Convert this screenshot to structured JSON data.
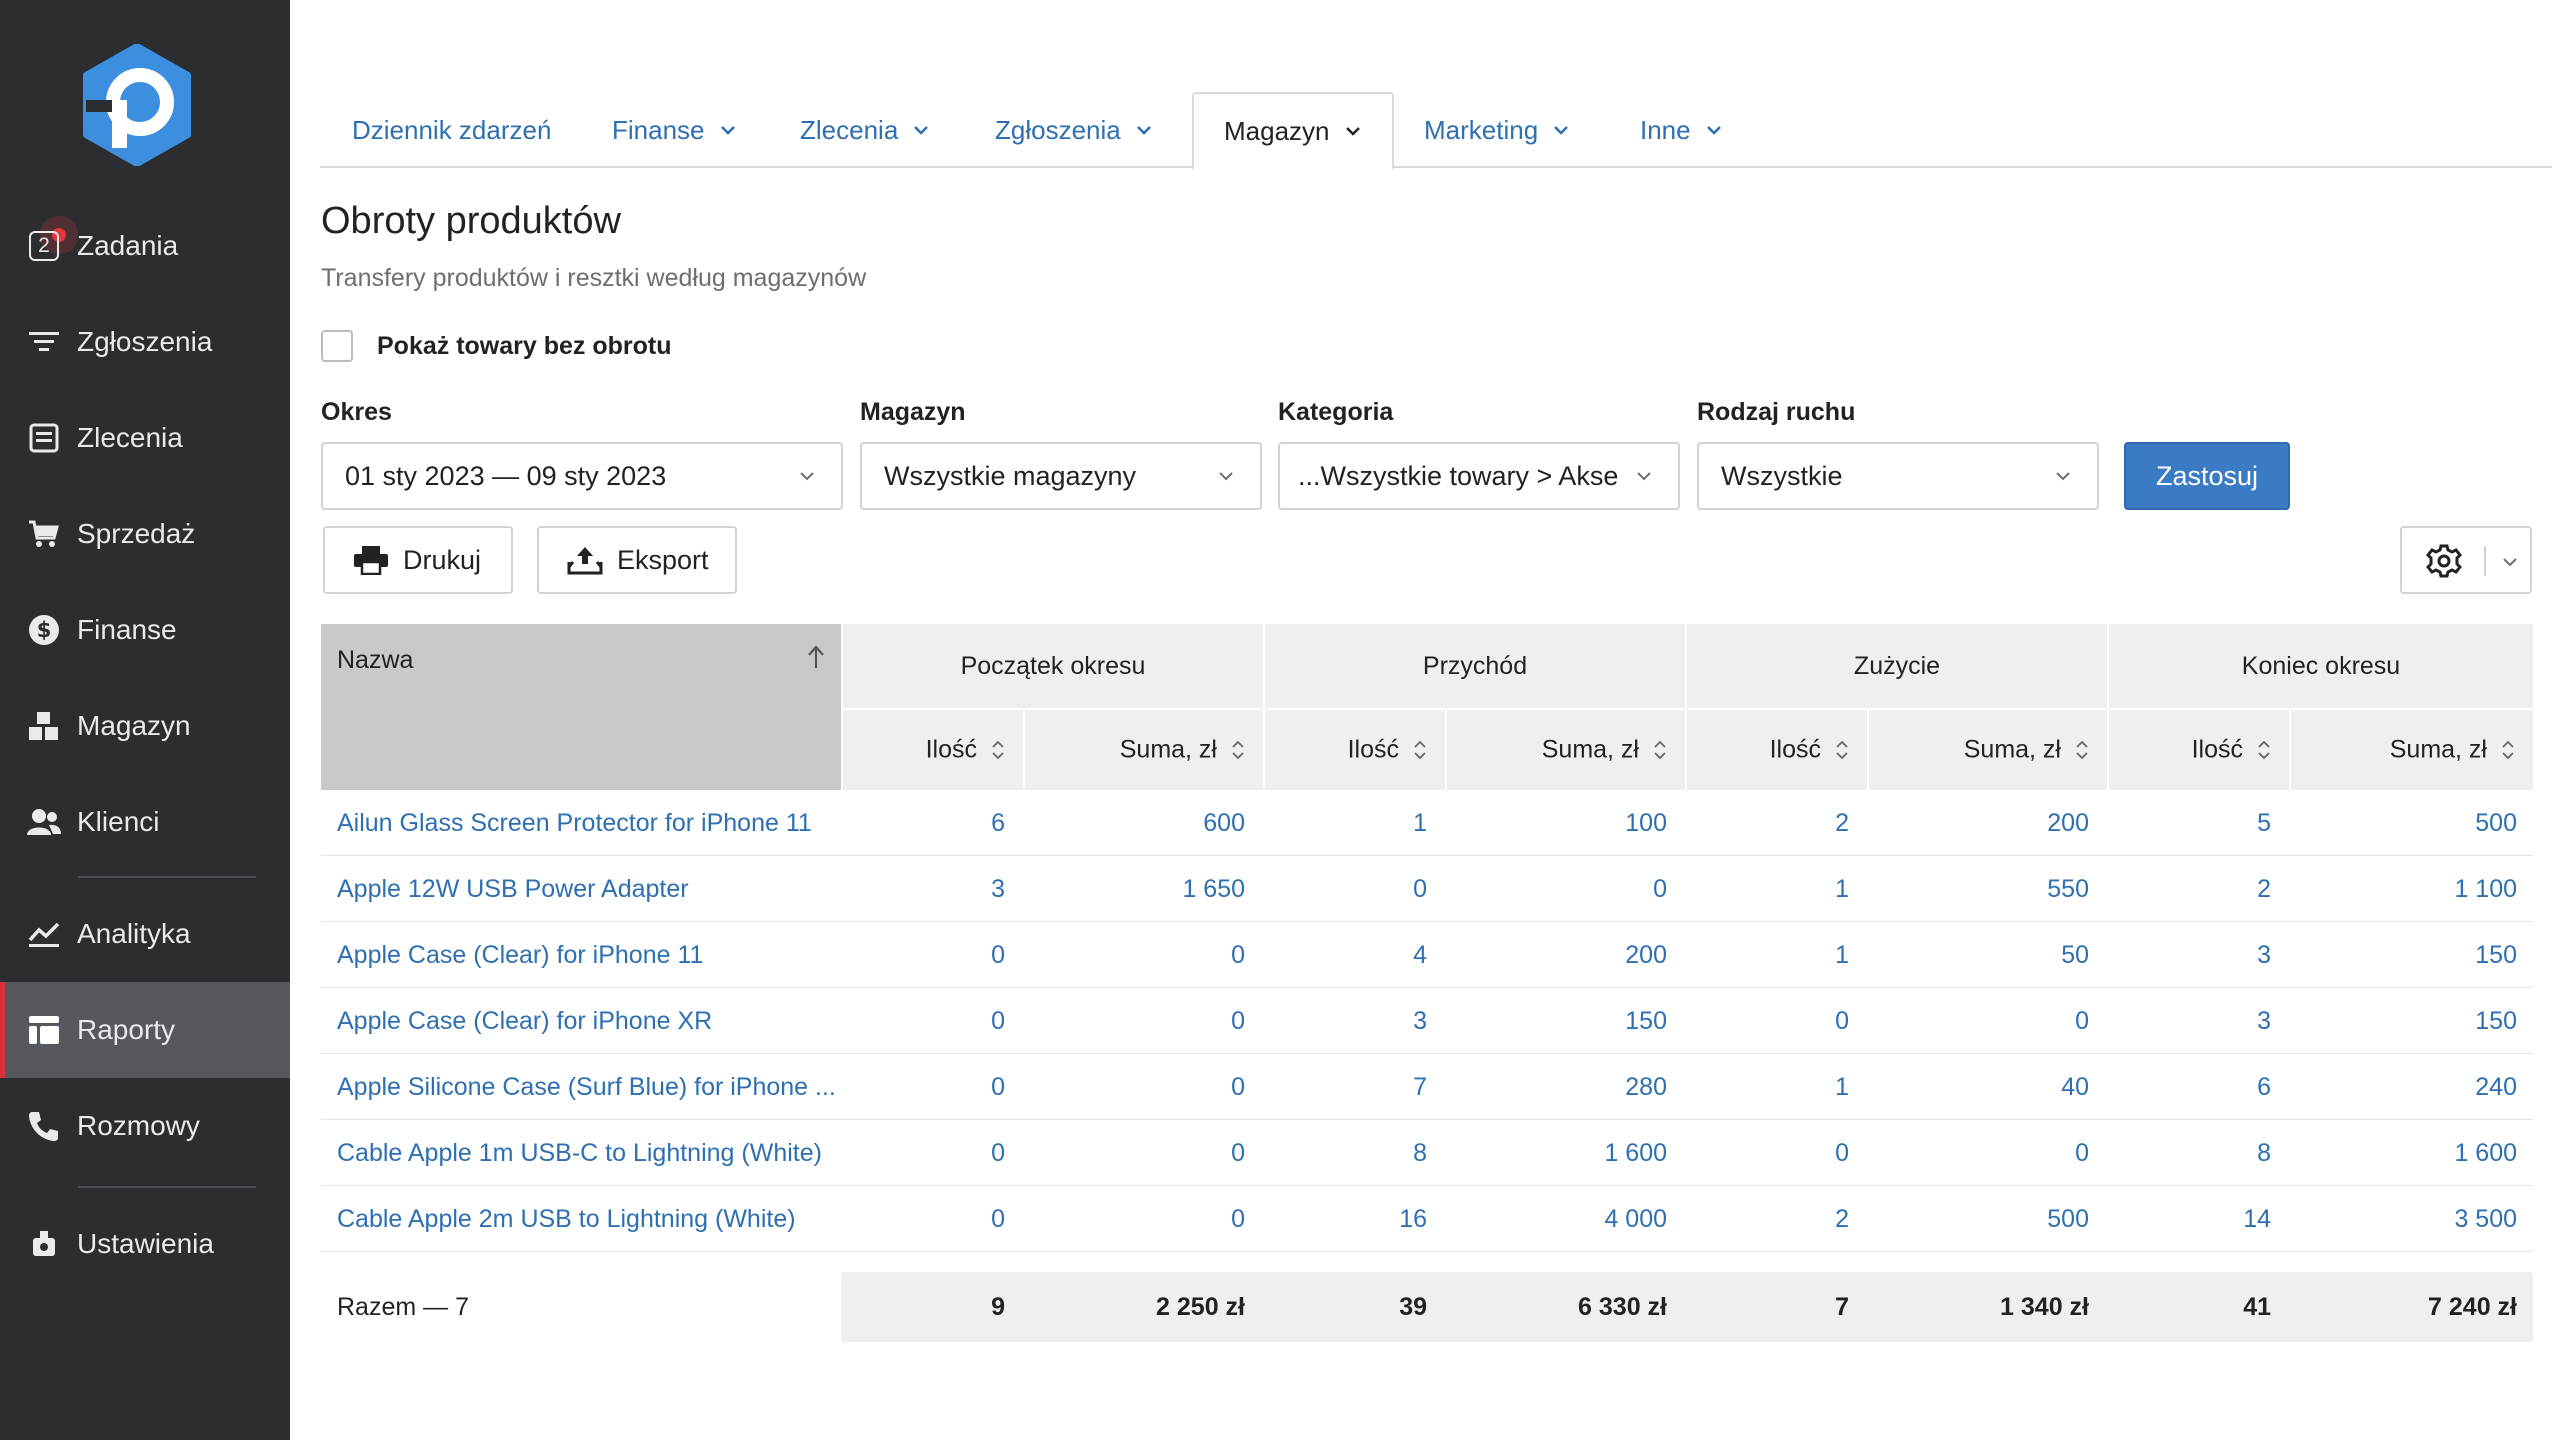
{
  "brand": {
    "accent": "#3b7bc4",
    "sidebar_bg": "#2b2d30",
    "active_marker": "#d9313a",
    "link": "#2e6fb2"
  },
  "sidebar": {
    "tasks_badge": "2",
    "items": [
      {
        "label": "Zadania",
        "icon": "tasks-icon"
      },
      {
        "label": "Zgłoszenia",
        "icon": "filter-icon"
      },
      {
        "label": "Zlecenia",
        "icon": "orders-icon"
      },
      {
        "label": "Sprzedaż",
        "icon": "cart-icon"
      },
      {
        "label": "Finanse",
        "icon": "dollar-icon"
      },
      {
        "label": "Magazyn",
        "icon": "warehouse-icon"
      },
      {
        "label": "Klienci",
        "icon": "clients-icon"
      },
      {
        "label": "Analityka",
        "icon": "analytics-icon"
      },
      {
        "label": "Raporty",
        "icon": "reports-icon",
        "active": true
      },
      {
        "label": "Rozmowy",
        "icon": "phone-icon"
      },
      {
        "label": "Ustawienia",
        "icon": "settings-icon"
      }
    ]
  },
  "tabs": [
    {
      "label": "Dziennik zdarzeń"
    },
    {
      "label": "Finanse"
    },
    {
      "label": "Zlecenia"
    },
    {
      "label": "Zgłoszenia"
    },
    {
      "label": "Magazyn",
      "active": true
    },
    {
      "label": "Marketing"
    },
    {
      "label": "Inne"
    }
  ],
  "header": {
    "title": "Obroty produktów",
    "subtitle": "Transfery produktów i resztki według magazynów",
    "checkbox_label": "Pokaż towary bez obrotu"
  },
  "filters": {
    "period_label": "Okres",
    "period_value": "01 sty 2023 — 09 sty 2023",
    "warehouse_label": "Magazyn",
    "warehouse_value": "Wszystkie magazyny",
    "category_label": "Kategoria",
    "category_value": "...Wszystkie towary > Akse",
    "movement_label": "Rodzaj ruchu",
    "movement_value": "Wszystkie",
    "apply_label": "Zastosuj"
  },
  "toolbar": {
    "print_label": "Drukuj",
    "export_label": "Eksport"
  },
  "table": {
    "name_header": "Nazwa",
    "groups": [
      "Początek okresu",
      "Przychód",
      "Zużycie",
      "Koniec okresu"
    ],
    "qty_header": "Ilość",
    "sum_header": "Suma, zł",
    "rows": [
      {
        "name": "Ailun Glass Screen Protector for iPhone 11",
        "v": [
          "6",
          "600",
          "1",
          "100",
          "2",
          "200",
          "5",
          "500"
        ]
      },
      {
        "name": "Apple 12W USB Power Adapter",
        "v": [
          "3",
          "1 650",
          "0",
          "0",
          "1",
          "550",
          "2",
          "1 100"
        ]
      },
      {
        "name": "Apple Case (Clear) for iPhone 11",
        "v": [
          "0",
          "0",
          "4",
          "200",
          "1",
          "50",
          "3",
          "150"
        ]
      },
      {
        "name": "Apple Case (Clear) for iPhone XR",
        "v": [
          "0",
          "0",
          "3",
          "150",
          "0",
          "0",
          "3",
          "150"
        ]
      },
      {
        "name": "Apple Silicone Case (Surf Blue) for iPhone ...",
        "v": [
          "0",
          "0",
          "7",
          "280",
          "1",
          "40",
          "6",
          "240"
        ]
      },
      {
        "name": "Cable Apple 1m USB-C to Lightning (White)",
        "v": [
          "0",
          "0",
          "8",
          "1 600",
          "0",
          "0",
          "8",
          "1 600"
        ]
      },
      {
        "name": "Cable Apple 2m USB to Lightning (White)",
        "v": [
          "0",
          "0",
          "16",
          "4 000",
          "2",
          "500",
          "14",
          "3 500"
        ]
      }
    ],
    "total_label": "Razem — 7",
    "totals": [
      "9",
      "2 250 zł",
      "39",
      "6 330 zł",
      "7",
      "1 340 zł",
      "41",
      "7 240 zł"
    ]
  }
}
